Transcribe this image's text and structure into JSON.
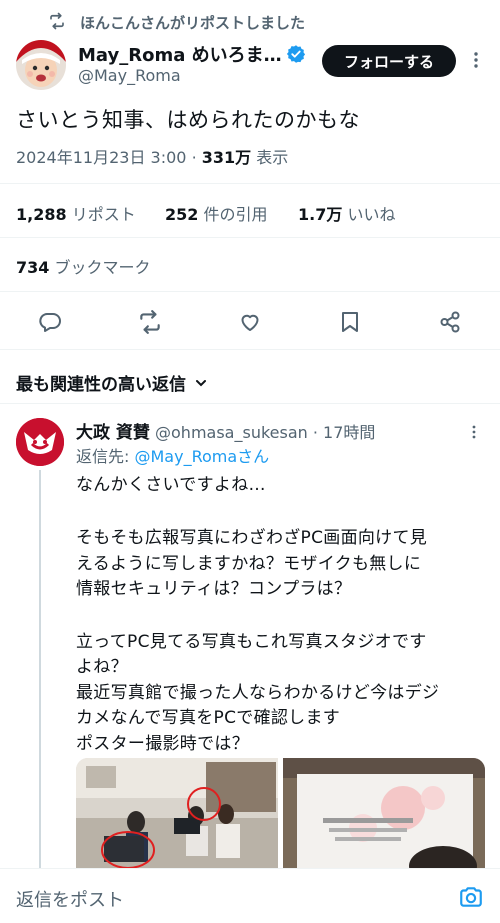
{
  "repost": {
    "text": "ほんこんさんがリポストしました",
    "icon": "repost-icon"
  },
  "author": {
    "name": "May_Roma めいろま…",
    "handle": "@May_Roma",
    "verified": true
  },
  "follow_label": "フォローする",
  "tweet": {
    "text": "さいとう知事、はめられたのかもな",
    "datetime": "2024年11月23日 3:00",
    "views": "331万",
    "views_label": "表示"
  },
  "stats": {
    "reposts": "1,288",
    "reposts_label": "リポスト",
    "quotes": "252",
    "quotes_label": "件の引用",
    "likes": "1.7万",
    "likes_label": "いいね",
    "bookmarks": "734",
    "bookmarks_label": "ブックマーク"
  },
  "relevant_replies_label": "最も関連性の高い返信",
  "reply": {
    "name": "大政 資賛",
    "handle": "@ohmasa_sukesan",
    "time": "17時間",
    "reply_to_label": "返信先:",
    "reply_to_user": "@May_Romaさん",
    "lines": [
      "なんかくさいですよね…",
      "そもそも広報写真にわざわざPC画面向けて見",
      "えるように写しますかね？モザイクも無しに",
      "情報セキュリティは？コンプラは？",
      "立ってPC見てる写真もこれ写真スタジオです",
      "よね？",
      "最近写真館で撮った人ならわかるけど今はデジ",
      "カメなんで写真をPCで確認します",
      "ポスター撮影時では？"
    ]
  },
  "reply_box": {
    "placeholder": "返信をポスト"
  },
  "colors": {
    "accent": "#1d9bf0",
    "text": "#0f1419",
    "muted": "#536471",
    "button": "#0f1419"
  }
}
